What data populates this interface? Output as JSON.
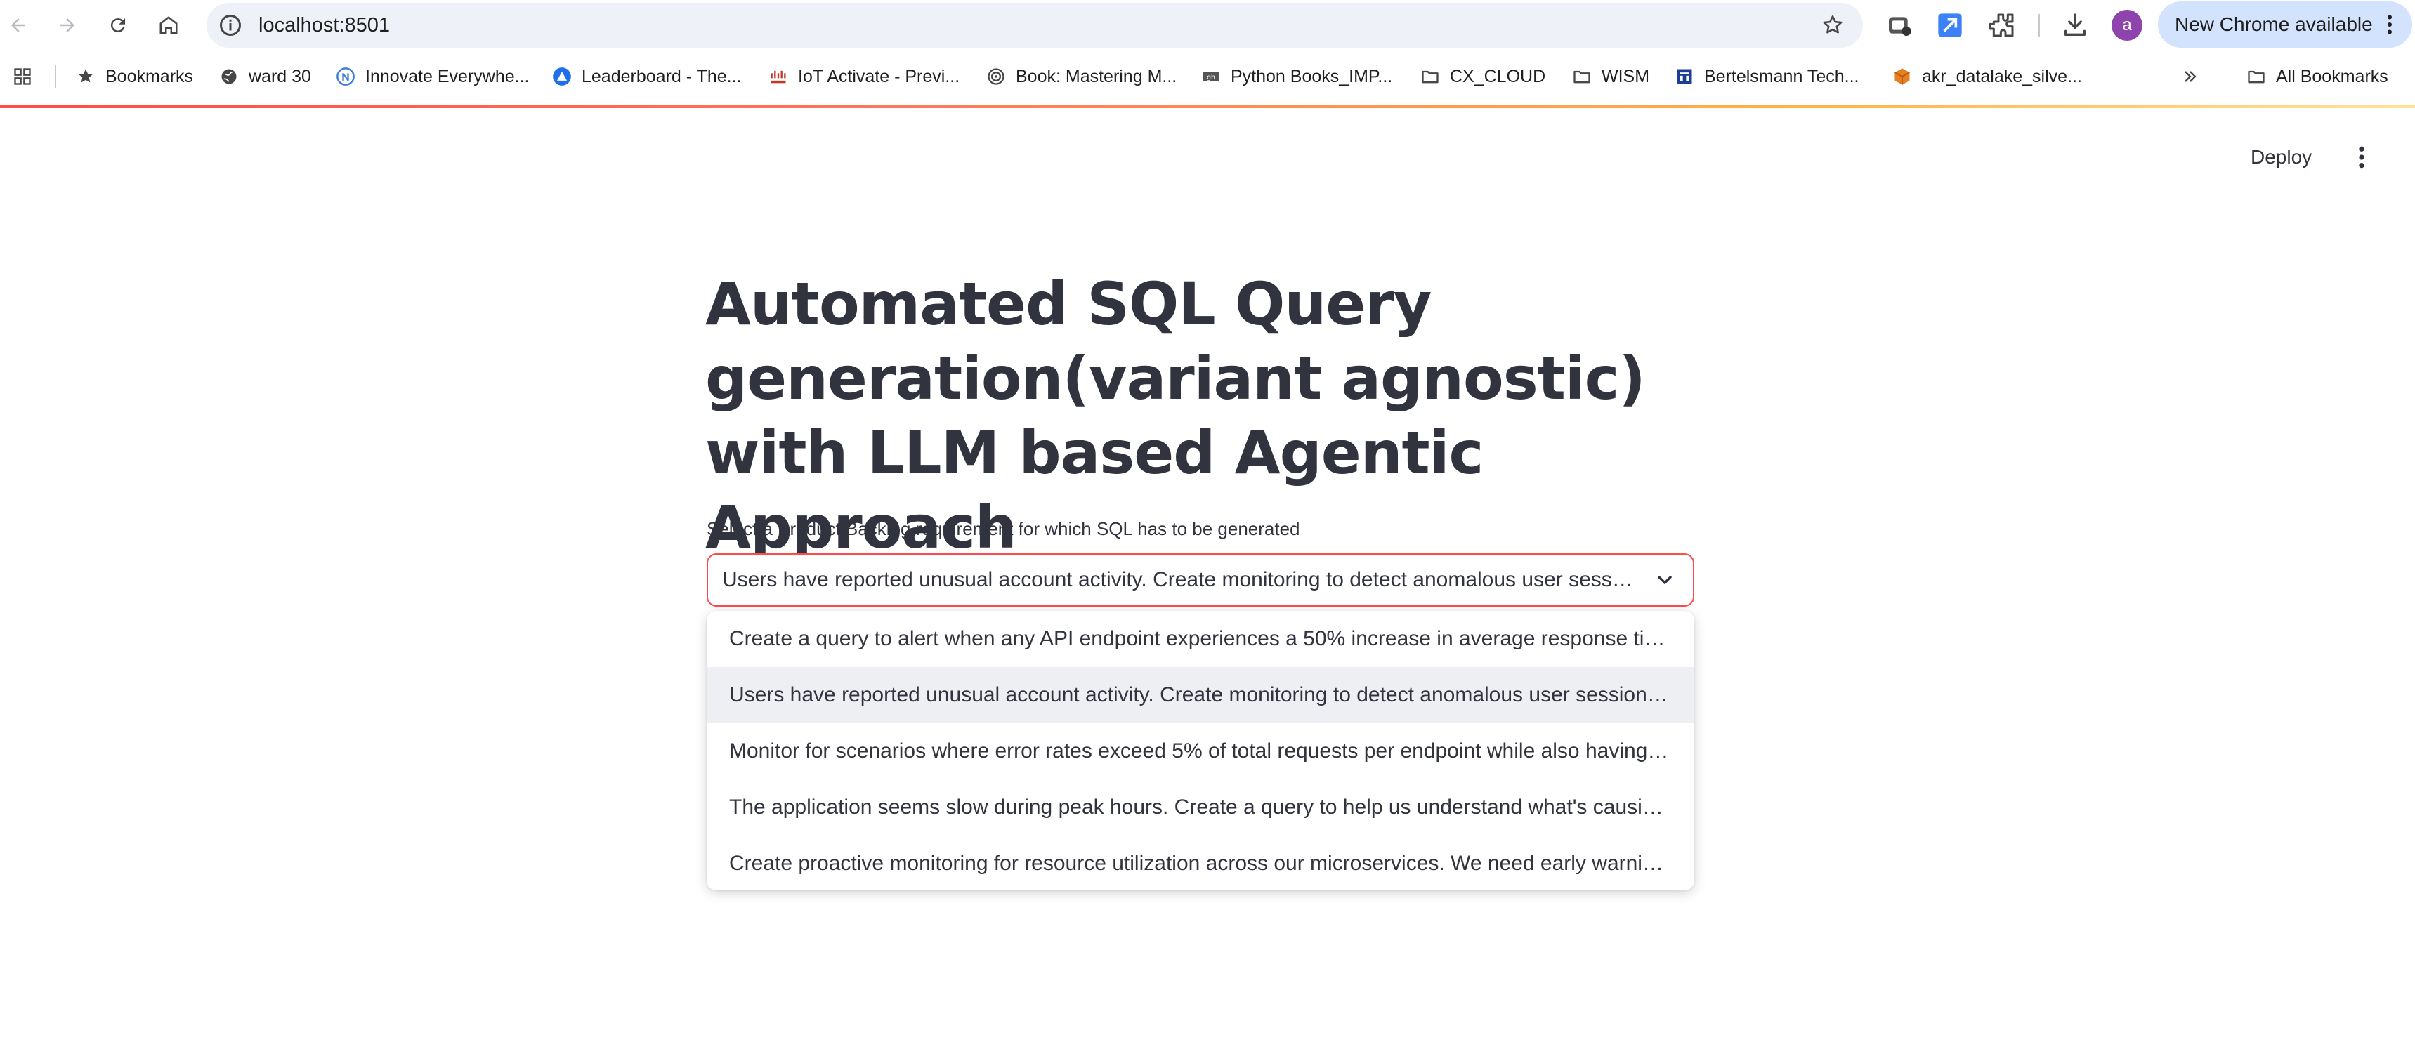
{
  "browser": {
    "url": "localhost:8501",
    "new_chrome_label": "New Chrome available",
    "avatar_letter": "a"
  },
  "bookmarks": {
    "items": [
      {
        "label": "Bookmarks",
        "icon": "star-icon"
      },
      {
        "label": "ward 30",
        "icon": "globe-icon"
      },
      {
        "label": "Innovate Everywhe...",
        "icon": "n-logo-icon"
      },
      {
        "label": "Leaderboard - The...",
        "icon": "triangle-logo-icon"
      },
      {
        "label": "IoT Activate - Previ...",
        "icon": "cisco-logo-icon"
      },
      {
        "label": "Book: Mastering M...",
        "icon": "swirl-logo-icon"
      },
      {
        "label": "Python Books_IMP...",
        "icon": "github-logo-icon"
      },
      {
        "label": "CX_CLOUD",
        "icon": "folder-icon"
      },
      {
        "label": "WISM",
        "icon": "folder-icon"
      },
      {
        "label": "Bertelsmann Tech...",
        "icon": "building-logo-icon"
      },
      {
        "label": "akr_datalake_silve...",
        "icon": "cube-logo-icon"
      }
    ],
    "all_bookmarks_label": "All Bookmarks"
  },
  "app": {
    "deploy_label": "Deploy",
    "title": "Automated SQL Query generation(variant agnostic) with LLM based Agentic Approach",
    "select_label": "Select a Product Backlog requirement for which SQL has to be generated",
    "selected_value": "Users have reported unusual account activity. Create monitoring to detect anomalous user session patterns",
    "options": [
      "Create a query to alert when any API endpoint experiences a 50% increase in average response time compared to its baseline",
      "Users have reported unusual account activity. Create monitoring to detect anomalous user session patterns",
      "Monitor for scenarios where error rates exceed 5% of total requests per endpoint while also having elevated latency",
      "The application seems slow during peak hours. Create a query to help us understand what's causing the slowdown",
      "Create proactive monitoring for resource utilization across our microservices. We need early warning signals"
    ],
    "highlighted_option_index": 1
  },
  "colors": {
    "accent": "#ff4b4b",
    "title_text": "#31333f",
    "highlight_bg": "#eeeff3",
    "new_chrome_bg": "#d3e3fd"
  }
}
